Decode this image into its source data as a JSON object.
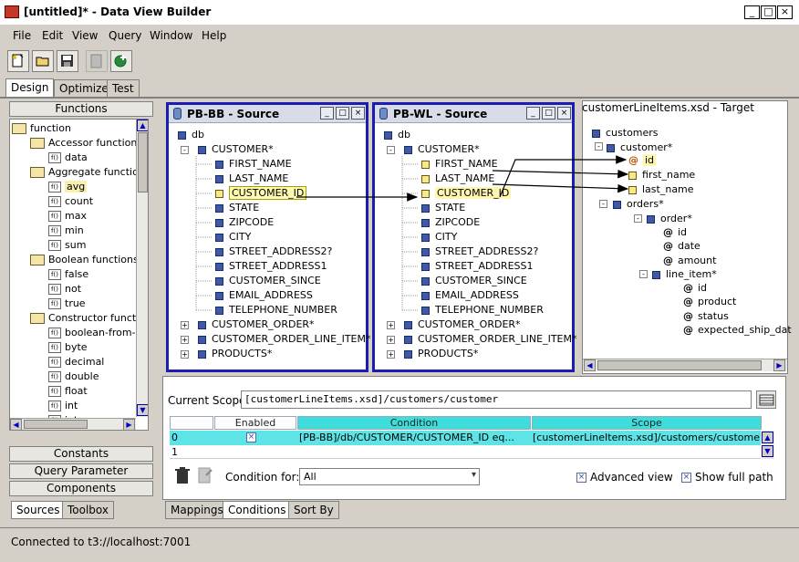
{
  "window": {
    "title": "[untitled]* - Data View Builder",
    "min": "_",
    "max": "□",
    "close": "×"
  },
  "menu": [
    "File",
    "Edit",
    "View",
    "Query",
    "Window",
    "Help"
  ],
  "tabs_top": [
    "Design",
    "Optimize",
    "Test"
  ],
  "left": {
    "header": "Functions",
    "tree": [
      {
        "kind": "folder",
        "label": "function",
        "level": 0
      },
      {
        "kind": "folder",
        "label": "Accessor functions",
        "level": 1
      },
      {
        "kind": "fn",
        "label": "data",
        "level": 2
      },
      {
        "kind": "folder",
        "label": "Aggregate functions",
        "level": 1
      },
      {
        "kind": "fn",
        "label": "avg",
        "level": 2,
        "selected": true
      },
      {
        "kind": "fn",
        "label": "count",
        "level": 2
      },
      {
        "kind": "fn",
        "label": "max",
        "level": 2
      },
      {
        "kind": "fn",
        "label": "min",
        "level": 2
      },
      {
        "kind": "fn",
        "label": "sum",
        "level": 2
      },
      {
        "kind": "folder",
        "label": "Boolean functions",
        "level": 1
      },
      {
        "kind": "fn",
        "label": "false",
        "level": 2
      },
      {
        "kind": "fn",
        "label": "not",
        "level": 2
      },
      {
        "kind": "fn",
        "label": "true",
        "level": 2
      },
      {
        "kind": "folder",
        "label": "Constructor functions",
        "level": 1
      },
      {
        "kind": "fn",
        "label": "boolean-from-st",
        "level": 2
      },
      {
        "kind": "fn",
        "label": "byte",
        "level": 2
      },
      {
        "kind": "fn",
        "label": "decimal",
        "level": 2
      },
      {
        "kind": "fn",
        "label": "double",
        "level": 2
      },
      {
        "kind": "fn",
        "label": "float",
        "level": 2
      },
      {
        "kind": "fn",
        "label": "int",
        "level": 2
      },
      {
        "kind": "fn",
        "label": "integer",
        "level": 2
      }
    ],
    "fn_icon": "f()",
    "sections": [
      "Constants",
      "Query Parameter",
      "Components"
    ],
    "bottom_tabs": [
      "Sources",
      "Toolbox"
    ]
  },
  "source1": {
    "title": "PB-BB - Source",
    "root": "db",
    "table": "CUSTOMER*",
    "fields": [
      "FIRST_NAME",
      "LAST_NAME",
      "CUSTOMER_ID",
      "STATE",
      "ZIPCODE",
      "CITY",
      "STREET_ADDRESS2?",
      "STREET_ADDRESS1",
      "CUSTOMER_SINCE",
      "EMAIL_ADDRESS",
      "TELEPHONE_NUMBER"
    ],
    "others": [
      "CUSTOMER_ORDER*",
      "CUSTOMER_ORDER_LINE_ITEM*",
      "PRODUCTS*"
    ]
  },
  "source2": {
    "title": "PB-WL - Source",
    "root": "db",
    "table": "CUSTOMER*",
    "fields": [
      "FIRST_NAME",
      "LAST_NAME",
      "CUSTOMER_ID",
      "STATE",
      "ZIPCODE",
      "CITY",
      "STREET_ADDRESS2?",
      "STREET_ADDRESS1",
      "CUSTOMER_SINCE",
      "EMAIL_ADDRESS",
      "TELEPHONE_NUMBER"
    ],
    "others": [
      "CUSTOMER_ORDER*",
      "CUSTOMER_ORDER_LINE_ITEM*",
      "PRODUCTS*"
    ]
  },
  "target": {
    "title": "customerLineItems.xsd - Target",
    "nodes": [
      "customers",
      "customer*",
      "id",
      "first_name",
      "last_name",
      "orders*",
      "order*",
      "id",
      "date",
      "amount",
      "line_item*",
      "id",
      "product",
      "status",
      "expected_ship_dat"
    ]
  },
  "scope": {
    "label": "Current Scope",
    "value": "[customerLineItems.xsd]/customers/customer",
    "columns": [
      "",
      "Enabled",
      "Condition",
      "Scope"
    ],
    "rows": [
      {
        "num": "0",
        "enabled": "×",
        "condition": "[PB-BB]/db/CUSTOMER/CUSTOMER_ID eq...",
        "scope": "[customerLineItems.xsd]/customers/customer"
      },
      {
        "num": "1",
        "enabled": "",
        "condition": "",
        "scope": ""
      }
    ],
    "condition_for_label": "Condition for:",
    "condition_for_value": "All",
    "advanced_view": "Advanced view",
    "show_full_path": "Show full path"
  },
  "bottom_tabs": [
    "Mappings",
    "Conditions",
    "Sort By"
  ],
  "status": "Connected to t3://localhost:7001"
}
